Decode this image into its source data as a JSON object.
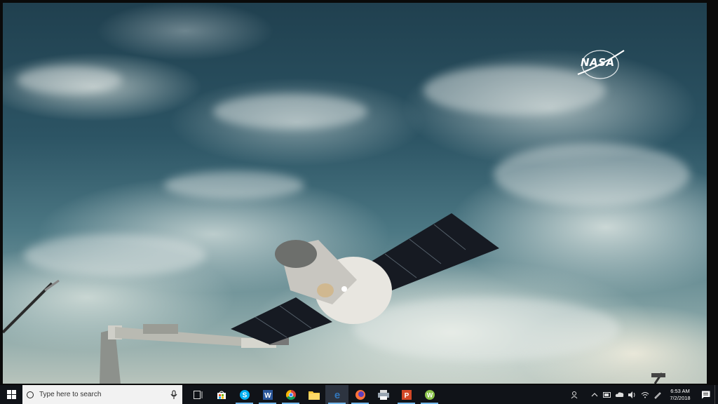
{
  "video": {
    "logo_text": "NASA"
  },
  "taskbar": {
    "search_placeholder": "Type here to search",
    "apps": [
      {
        "name": "task-view",
        "glyph": "⧉"
      },
      {
        "name": "store",
        "glyph": "🛍"
      },
      {
        "name": "skype",
        "glyph": "S"
      },
      {
        "name": "word",
        "glyph": "W"
      },
      {
        "name": "chrome",
        "glyph": "◉"
      },
      {
        "name": "file-explorer",
        "glyph": "▬"
      },
      {
        "name": "edge",
        "glyph": "e"
      },
      {
        "name": "firefox",
        "glyph": "◐"
      },
      {
        "name": "printer",
        "glyph": "▭"
      },
      {
        "name": "powerpoint",
        "glyph": "P"
      },
      {
        "name": "wps",
        "glyph": "W"
      }
    ],
    "clock": {
      "time": "6:53 AM",
      "date": "7/2/2018"
    }
  },
  "colors": {
    "taskbar_bg": "#101318",
    "accent": "#76b9ed"
  }
}
